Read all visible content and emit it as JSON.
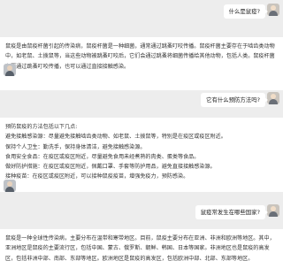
{
  "conversation": [
    {
      "role": "user",
      "text": "什么是鼠疫?"
    },
    {
      "role": "bot",
      "paragraphs": [
        "鼠疫是由鼠疫杆菌引起的传染病，鼠疫杆菌是一种细菌，通常通过跳蚤叮咬传播。鼠疫杆菌主要存在于啮齿类动物中，如老鼠、土拨鼠等，当这些动物被跳蚤叮咬后，它们会通过跳蚤将细菌传播给其他动物，包括人类。鼠疫杆菌主要通过跳蚤叮咬传播，也可以通过直接接触感染。"
      ]
    },
    {
      "role": "user",
      "text": "它有什么预防方法吗?"
    },
    {
      "role": "bot",
      "lines": [
        "预防鼠疫的方法包括以下几点:",
        "避免接触感染源：尽量避免接触啮齿类动物、如老鼠、土拨鼠等，特别是在疫区或疫区附近。",
        "保持个人卫生：勤洗手，保持身体清洁，避免接触感染源。",
        "食用安全食品：在疫区或疫区附近，尽量避免食用未经煮熟的肉类、蛋类等食品。",
        "做好防护措施：在疫区或疫区附近，佩戴口罩、手套等防护用品，避免直接接触感染源。",
        "接种疫苗：在疫区或疫区附近，可以接种鼠疫疫苗，增强免疫力，预防感染。"
      ]
    },
    {
      "role": "user",
      "text": "鼠疫常发生在哪些国家?"
    },
    {
      "role": "bot",
      "paragraphs": [
        "鼠疫是一种全球性传染病，主要分布在温带和寒带地区。目前，鼠疫主要分布在亚洲、非洲和欧洲等地区。其中，亚洲地区是鼠疫的主要流行区，包括中国、蒙古、俄罗斯、朝鲜、韩国、日本等国家。非洲地区也是鼠疫的高发区，包括非洲中部、南部、东部等地区。欧洲地区是鼠疫的高发区，包括欧洲中部、北部、东部等地区。"
      ]
    }
  ]
}
